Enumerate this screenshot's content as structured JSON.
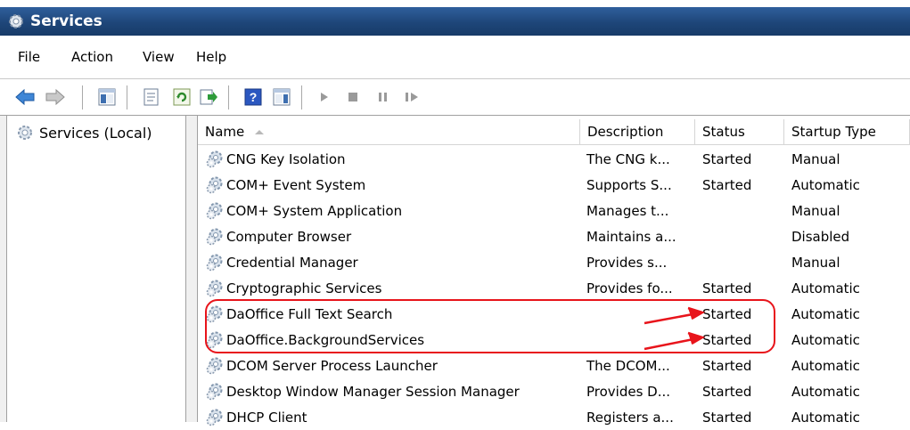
{
  "window": {
    "title": "Services"
  },
  "menu": [
    {
      "label": "File"
    },
    {
      "label": "Action"
    },
    {
      "label": "View"
    },
    {
      "label": "Help"
    }
  ],
  "tree": {
    "root_label": "Services (Local)"
  },
  "columns": {
    "name": "Name",
    "description": "Description",
    "status": "Status",
    "startup": "Startup Type"
  },
  "services": [
    {
      "name": "CNG Key Isolation",
      "description": "The CNG k...",
      "status": "Started",
      "startup": "Manual"
    },
    {
      "name": "COM+ Event System",
      "description": "Supports S...",
      "status": "Started",
      "startup": "Automatic"
    },
    {
      "name": "COM+ System Application",
      "description": "Manages t...",
      "status": "",
      "startup": "Manual"
    },
    {
      "name": "Computer Browser",
      "description": "Maintains a...",
      "status": "",
      "startup": "Disabled"
    },
    {
      "name": "Credential Manager",
      "description": "Provides s...",
      "status": "",
      "startup": "Manual"
    },
    {
      "name": "Cryptographic Services",
      "description": "Provides fo...",
      "status": "Started",
      "startup": "Automatic"
    },
    {
      "name": "DaOffice Full Text Search",
      "description": "",
      "status": "Started",
      "startup": "Automatic"
    },
    {
      "name": "DaOffice.BackgroundServices",
      "description": "",
      "status": "Started",
      "startup": "Automatic"
    },
    {
      "name": "DCOM Server Process Launcher",
      "description": "The DCOM...",
      "status": "Started",
      "startup": "Automatic"
    },
    {
      "name": "Desktop Window Manager Session Manager",
      "description": "Provides D...",
      "status": "Started",
      "startup": "Automatic"
    },
    {
      "name": "DHCP Client",
      "description": "Registers a...",
      "status": "Started",
      "startup": "Automatic"
    }
  ],
  "toolbar": {
    "icons": [
      "back-arrow-icon",
      "forward-arrow-icon",
      "show-hide-tree-icon",
      "properties-icon",
      "refresh-icon",
      "export-list-icon",
      "help-icon",
      "show-hide-action-pane-icon",
      "start-service-icon",
      "stop-service-icon",
      "pause-service-icon",
      "restart-service-icon"
    ]
  },
  "colors": {
    "titlebar": "#1e4679",
    "annotation": "#e8141b"
  }
}
